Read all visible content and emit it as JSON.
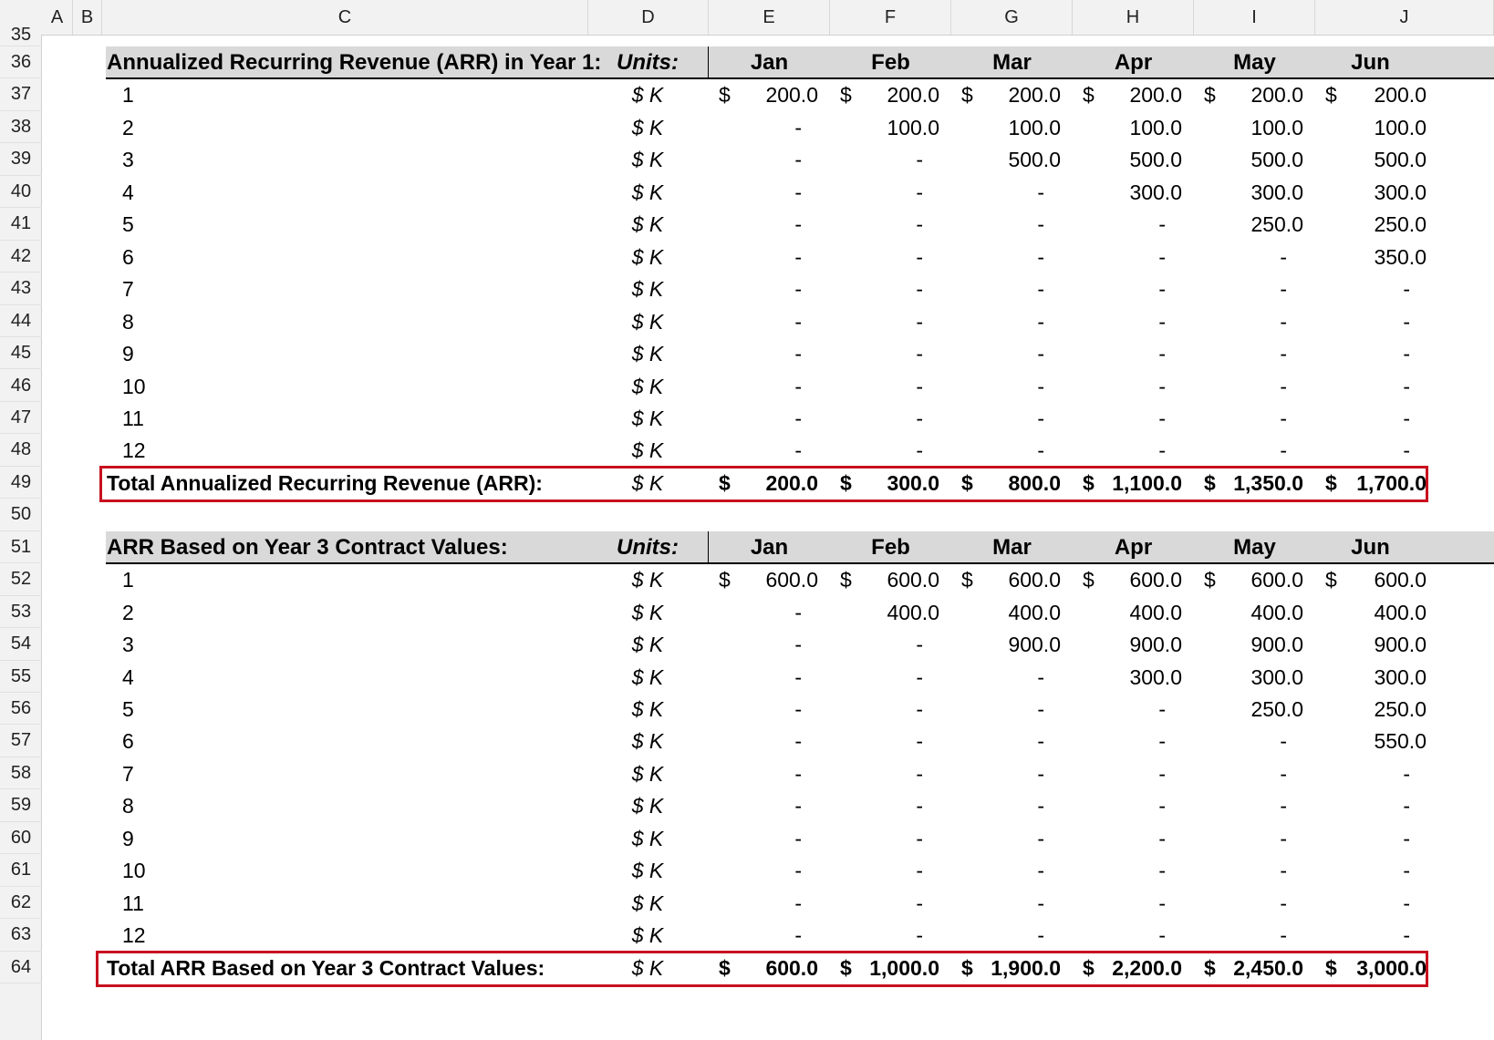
{
  "columns": [
    "A",
    "B",
    "C",
    "D",
    "E",
    "F",
    "G",
    "H",
    "I",
    "J"
  ],
  "top_row_partial": "35",
  "row_numbers": [
    "36",
    "37",
    "38",
    "39",
    "40",
    "41",
    "42",
    "43",
    "44",
    "45",
    "46",
    "47",
    "48",
    "49",
    "50",
    "51",
    "52",
    "53",
    "54",
    "55",
    "56",
    "57",
    "58",
    "59",
    "60",
    "61",
    "62",
    "63",
    "64"
  ],
  "units_label": "Units:",
  "unit": "$ K",
  "currency_symbol": "$",
  "months": [
    "Jan",
    "Feb",
    "Mar",
    "Apr",
    "May",
    "Jun"
  ],
  "sections": [
    {
      "title": "Annualized Recurring Revenue (ARR) in Year 1:",
      "rows": [
        {
          "label": "1",
          "values": [
            "200.0",
            "200.0",
            "200.0",
            "200.0",
            "200.0",
            "200.0"
          ]
        },
        {
          "label": "2",
          "values": [
            "-",
            "100.0",
            "100.0",
            "100.0",
            "100.0",
            "100.0"
          ]
        },
        {
          "label": "3",
          "values": [
            "-",
            "-",
            "500.0",
            "500.0",
            "500.0",
            "500.0"
          ]
        },
        {
          "label": "4",
          "values": [
            "-",
            "-",
            "-",
            "300.0",
            "300.0",
            "300.0"
          ]
        },
        {
          "label": "5",
          "values": [
            "-",
            "-",
            "-",
            "-",
            "250.0",
            "250.0"
          ]
        },
        {
          "label": "6",
          "values": [
            "-",
            "-",
            "-",
            "-",
            "-",
            "350.0"
          ]
        },
        {
          "label": "7",
          "values": [
            "-",
            "-",
            "-",
            "-",
            "-",
            "-"
          ]
        },
        {
          "label": "8",
          "values": [
            "-",
            "-",
            "-",
            "-",
            "-",
            "-"
          ]
        },
        {
          "label": "9",
          "values": [
            "-",
            "-",
            "-",
            "-",
            "-",
            "-"
          ]
        },
        {
          "label": "10",
          "values": [
            "-",
            "-",
            "-",
            "-",
            "-",
            "-"
          ]
        },
        {
          "label": "11",
          "values": [
            "-",
            "-",
            "-",
            "-",
            "-",
            "-"
          ]
        },
        {
          "label": "12",
          "values": [
            "-",
            "-",
            "-",
            "-",
            "-",
            "-"
          ]
        }
      ],
      "total_label": "Total Annualized Recurring Revenue (ARR):",
      "total_values": [
        "200.0",
        "300.0",
        "800.0",
        "1,100.0",
        "1,350.0",
        "1,700.0"
      ]
    },
    {
      "title": "ARR Based on Year 3 Contract Values:",
      "rows": [
        {
          "label": "1",
          "values": [
            "600.0",
            "600.0",
            "600.0",
            "600.0",
            "600.0",
            "600.0"
          ]
        },
        {
          "label": "2",
          "values": [
            "-",
            "400.0",
            "400.0",
            "400.0",
            "400.0",
            "400.0"
          ]
        },
        {
          "label": "3",
          "values": [
            "-",
            "-",
            "900.0",
            "900.0",
            "900.0",
            "900.0"
          ]
        },
        {
          "label": "4",
          "values": [
            "-",
            "-",
            "-",
            "300.0",
            "300.0",
            "300.0"
          ]
        },
        {
          "label": "5",
          "values": [
            "-",
            "-",
            "-",
            "-",
            "250.0",
            "250.0"
          ]
        },
        {
          "label": "6",
          "values": [
            "-",
            "-",
            "-",
            "-",
            "-",
            "550.0"
          ]
        },
        {
          "label": "7",
          "values": [
            "-",
            "-",
            "-",
            "-",
            "-",
            "-"
          ]
        },
        {
          "label": "8",
          "values": [
            "-",
            "-",
            "-",
            "-",
            "-",
            "-"
          ]
        },
        {
          "label": "9",
          "values": [
            "-",
            "-",
            "-",
            "-",
            "-",
            "-"
          ]
        },
        {
          "label": "10",
          "values": [
            "-",
            "-",
            "-",
            "-",
            "-",
            "-"
          ]
        },
        {
          "label": "11",
          "values": [
            "-",
            "-",
            "-",
            "-",
            "-",
            "-"
          ]
        },
        {
          "label": "12",
          "values": [
            "-",
            "-",
            "-",
            "-",
            "-",
            "-"
          ]
        }
      ],
      "total_label": "Total ARR Based on Year 3 Contract Values:",
      "total_values": [
        "600.0",
        "1,000.0",
        "1,900.0",
        "2,200.0",
        "2,450.0",
        "3,000.0"
      ]
    }
  ],
  "colors": {
    "header_fill": "#d9d9d9",
    "total_outline": "#c8101f",
    "grid_header_bg": "#f2f2f2"
  }
}
